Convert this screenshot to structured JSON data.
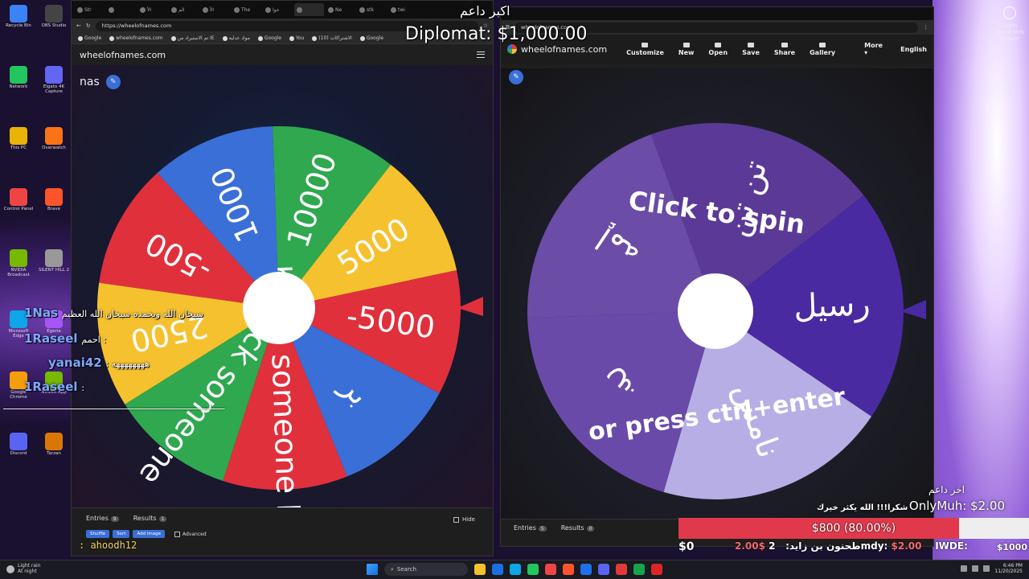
{
  "left_window": {
    "tabs": [
      "Str",
      "",
      "الأ",
      "الم",
      "الأ",
      "The",
      "جوا",
      "",
      "Ne",
      "stk",
      "twi"
    ],
    "url": "https://wheelofnames.com",
    "bookmarks": [
      "Google",
      "wheelofnames.com",
      "تم الاستيراد من IE",
      "مواد عدلية",
      "Google",
      "You",
      "الاشتراكات (10)",
      "Google"
    ],
    "site_name": "wheelofnames.com",
    "wheel_title": "nas",
    "wheel_segments": [
      {
        "label": "10000",
        "color": "#2fa84f"
      },
      {
        "label": "5000",
        "color": "#f5c12e"
      },
      {
        "label": "-5000",
        "color": "#e0303c"
      },
      {
        "label": "بر",
        "color": "#3a6fd8"
      },
      {
        "label": "bring someone back",
        "color": "#e0303c"
      },
      {
        "label": "kick someone",
        "color": "#2fa84f"
      },
      {
        "label": "2500",
        "color": "#f5c12e"
      },
      {
        "label": "-500",
        "color": "#e0303c"
      },
      {
        "label": "1000",
        "color": "#3a6fd8"
      }
    ],
    "tab_entries": "Entries",
    "entries_count": "9",
    "tab_results": "Results",
    "results_count": "1",
    "hide_label": "Hide",
    "btn_shuffle": "Shuffle",
    "btn_sort": "Sort",
    "btn_add_image": "Add image",
    "advanced_label": "Advanced"
  },
  "right_window": {
    "url": "wheelofnames.com",
    "brand": "wheelofnames.com",
    "menu": [
      "Customize",
      "New",
      "Open",
      "Save",
      "Share",
      "Gallery"
    ],
    "more": "More",
    "language": "English",
    "wheel_segments": [
      {
        "label": "تن تن",
        "color": "#5a3a96"
      },
      {
        "label": "رسيل",
        "color": "#4a2aa0"
      },
      {
        "label": "نامس",
        "color": "#b7aee6"
      },
      {
        "label": "غ",
        "color": "#6a4aa8"
      },
      {
        "label": "إمه",
        "color": "#6b4ca6"
      }
    ],
    "spin_line1": "Click to spin",
    "spin_line2": "or press ctrl+enter",
    "tab_entries": "Entries",
    "entries_count": "5",
    "tab_results": "Results",
    "results_count": "0"
  },
  "overlays": {
    "top_donation_title": "اكبر داعم",
    "top_donation": "Diplomat: $1,000.00",
    "chat": [
      {
        "name": "1Nas",
        "text": "سبحان الله وبحمده سبحان الله العظيم"
      },
      {
        "name": "1Raseel",
        "text": "احمم :"
      },
      {
        "name": "yanai42",
        "text": ": ههههههههه"
      },
      {
        "name": "1Raseel",
        "text": ":"
      }
    ],
    "chat_wave": "ــــــــــــــــــــــــــــــــــــــــــــــــــــــــــــــــــــــــــــــــــــــــــــــ",
    "bottom_chat_name": ": ahoodh12",
    "latest_supporter_label": "اخر داعم",
    "latest_supporter": "OnlyMuh: $2.00",
    "thanks_text": "شكرا!!! الله يكثر خيرك",
    "goal_text": "$800 (80.00%)",
    "goal_progress": 0.8,
    "goal_start": "$0",
    "goal_end": "$1000",
    "ticker_prefix": "طحنون بن زايد:",
    "ticker_amount_1": "2.00$",
    "ticker_name_2": "2mdy:",
    "ticker_amount_2": "$2.00",
    "ticker_name_3": "IWDE:"
  },
  "desktop_icons": [
    "Recycle Bin",
    "Network",
    "This PC",
    "Control Panel",
    "NVIDIA Broadcast",
    "Microsoft Edge",
    "Google Chrome",
    "Discord",
    "OBS Studio",
    "Elgato 4K Capture",
    "Overwatch",
    "Brave",
    "SILENT HILL 2",
    "Egeria",
    "NVIDIA App",
    "Tarzan"
  ],
  "learn_about": "Learn about this picture",
  "taskbar": {
    "weather_line1": "Light rain",
    "weather_line2": "At night",
    "search": "Search",
    "time": "6:46 PM",
    "date": "11/20/2025"
  }
}
